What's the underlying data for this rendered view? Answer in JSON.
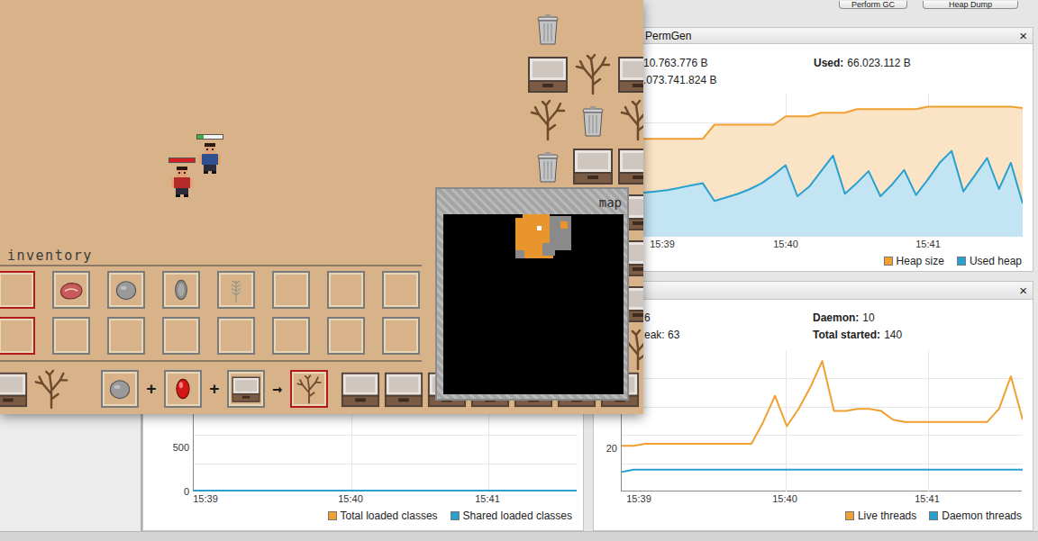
{
  "toolbar": {
    "buttons": [
      "Perform GC",
      "Heap Dump"
    ]
  },
  "heap_panel": {
    "tab": "PermGen",
    "close": "×",
    "stats_left": [
      "10.763.776 B",
      ".073.741.824 B"
    ],
    "stats_right": [
      {
        "label": "Used:",
        "value": "66.023.112 B"
      }
    ],
    "chart": {
      "x_ticks": [
        "15:39",
        "15:40",
        "15:41"
      ],
      "y_ticks": [],
      "series": [
        {
          "name": "Heap size",
          "color": "#f0a030",
          "values": [
            82,
            82,
            82,
            82,
            82,
            82,
            94,
            94,
            94,
            94,
            94,
            94,
            101,
            101,
            101,
            104,
            104,
            104,
            107,
            107,
            107,
            107,
            107,
            107,
            109,
            109,
            109,
            109,
            109,
            109,
            109,
            109,
            108
          ]
        },
        {
          "name": "Used heap",
          "color": "#2aa0d0",
          "values": [
            37,
            38,
            39,
            41,
            43,
            45,
            30,
            33,
            36,
            40,
            45,
            52,
            60,
            34,
            42,
            55,
            68,
            36,
            45,
            55,
            34,
            44,
            56,
            35,
            48,
            62,
            72,
            38,
            52,
            66,
            40,
            62,
            28
          ]
        }
      ]
    }
  },
  "classes_panel": {
    "chart": {
      "x_ticks": [
        "15:39",
        "15:40",
        "15:41"
      ],
      "y_ticks": [
        "500",
        "0"
      ],
      "series": [
        {
          "name": "Total loaded classes",
          "color": "#f0a030",
          "values": []
        },
        {
          "name": "Shared loaded classes",
          "color": "#2aa0d0",
          "values": [
            0,
            0,
            0,
            0,
            0,
            0,
            0,
            0,
            0,
            0,
            0,
            0,
            0,
            0,
            0,
            0,
            0,
            0,
            0,
            0,
            0,
            0,
            0,
            0,
            0,
            0,
            0,
            0,
            0,
            0,
            0,
            0,
            0,
            0
          ]
        }
      ]
    }
  },
  "threads_panel": {
    "close": "×",
    "stats_left": [
      "6",
      "eak: 63"
    ],
    "stats_right": [
      {
        "label": "Daemon:",
        "value": "10"
      },
      {
        "label": "Total started:",
        "value": "140"
      }
    ],
    "chart": {
      "x_ticks": [
        "15:39",
        "15:40",
        "15:41"
      ],
      "y_ticks": [
        "20"
      ],
      "series": [
        {
          "name": "Live threads",
          "color": "#f0a030",
          "values": [
            21,
            21,
            22,
            22,
            22,
            22,
            22,
            22,
            22,
            22,
            22,
            22,
            32,
            44,
            30,
            38,
            48,
            60,
            37,
            37,
            38,
            38,
            37,
            33,
            32,
            32,
            32,
            32,
            32,
            32,
            32,
            32,
            38,
            53,
            33
          ]
        },
        {
          "name": "Daemon threads",
          "color": "#2aa0d0",
          "values": [
            9,
            10,
            10,
            10,
            10,
            10,
            10,
            10,
            10,
            10,
            10,
            10,
            10,
            10,
            10,
            10,
            10,
            10,
            10,
            10,
            10,
            10,
            10,
            10,
            10,
            10,
            10,
            10,
            10,
            10,
            10,
            10,
            10,
            10,
            10
          ]
        }
      ]
    }
  },
  "game": {
    "characters": [
      {
        "color": "#2f4f8f",
        "bar_color": "#3cb043",
        "level": 0.25
      },
      {
        "color": "#b52a2a",
        "bar_color": "#d42020",
        "level": 1
      }
    ],
    "tiles": [
      [
        "trash",
        "sand",
        "sand"
      ],
      [
        "chest",
        "tree",
        "chest"
      ],
      [
        "tree",
        "trash",
        "tree"
      ],
      [
        "trash",
        "chest",
        "chest"
      ],
      [
        "chest"
      ],
      [
        "chest"
      ],
      [
        "chest"
      ],
      [
        "tree"
      ]
    ],
    "inventory": {
      "title": "inventory",
      "rows": [
        [
          {
            "kind": "empty",
            "selected": true
          },
          {
            "kind": "meat",
            "selected": false
          },
          {
            "kind": "stone",
            "selected": false
          },
          {
            "kind": "flint",
            "selected": false
          },
          {
            "kind": "wheat",
            "selected": false
          },
          {
            "kind": "empty",
            "selected": false
          },
          {
            "kind": "empty",
            "selected": false
          },
          {
            "kind": "empty",
            "selected": false
          }
        ],
        [
          {
            "kind": "empty",
            "selected": true
          },
          {
            "kind": "empty",
            "selected": false
          },
          {
            "kind": "empty",
            "selected": false
          },
          {
            "kind": "empty",
            "selected": false
          },
          {
            "kind": "empty",
            "selected": false
          },
          {
            "kind": "empty",
            "selected": false
          },
          {
            "kind": "empty",
            "selected": false
          },
          {
            "kind": "empty",
            "selected": false
          }
        ]
      ]
    },
    "hotbar": [
      {
        "kind": "chest",
        "boxed": false
      },
      {
        "kind": "tree",
        "boxed": false
      },
      {
        "kind": "stone",
        "boxed": true,
        "selected": false
      },
      {
        "kind": "op",
        "text": "+"
      },
      {
        "kind": "gem",
        "boxed": true,
        "selected": false
      },
      {
        "kind": "op",
        "text": "+"
      },
      {
        "kind": "chest",
        "boxed": true,
        "selected": false
      },
      {
        "kind": "op",
        "text": "→"
      },
      {
        "kind": "tree",
        "boxed": true,
        "selected": true
      },
      {
        "kind": "chest",
        "boxed": false
      },
      {
        "kind": "chest",
        "boxed": false
      },
      {
        "kind": "chest",
        "boxed": false
      },
      {
        "kind": "chest",
        "boxed": false
      },
      {
        "kind": "chest",
        "boxed": false
      },
      {
        "kind": "chest",
        "boxed": false
      },
      {
        "kind": "chest",
        "boxed": false
      }
    ],
    "map": {
      "title": "map"
    }
  }
}
